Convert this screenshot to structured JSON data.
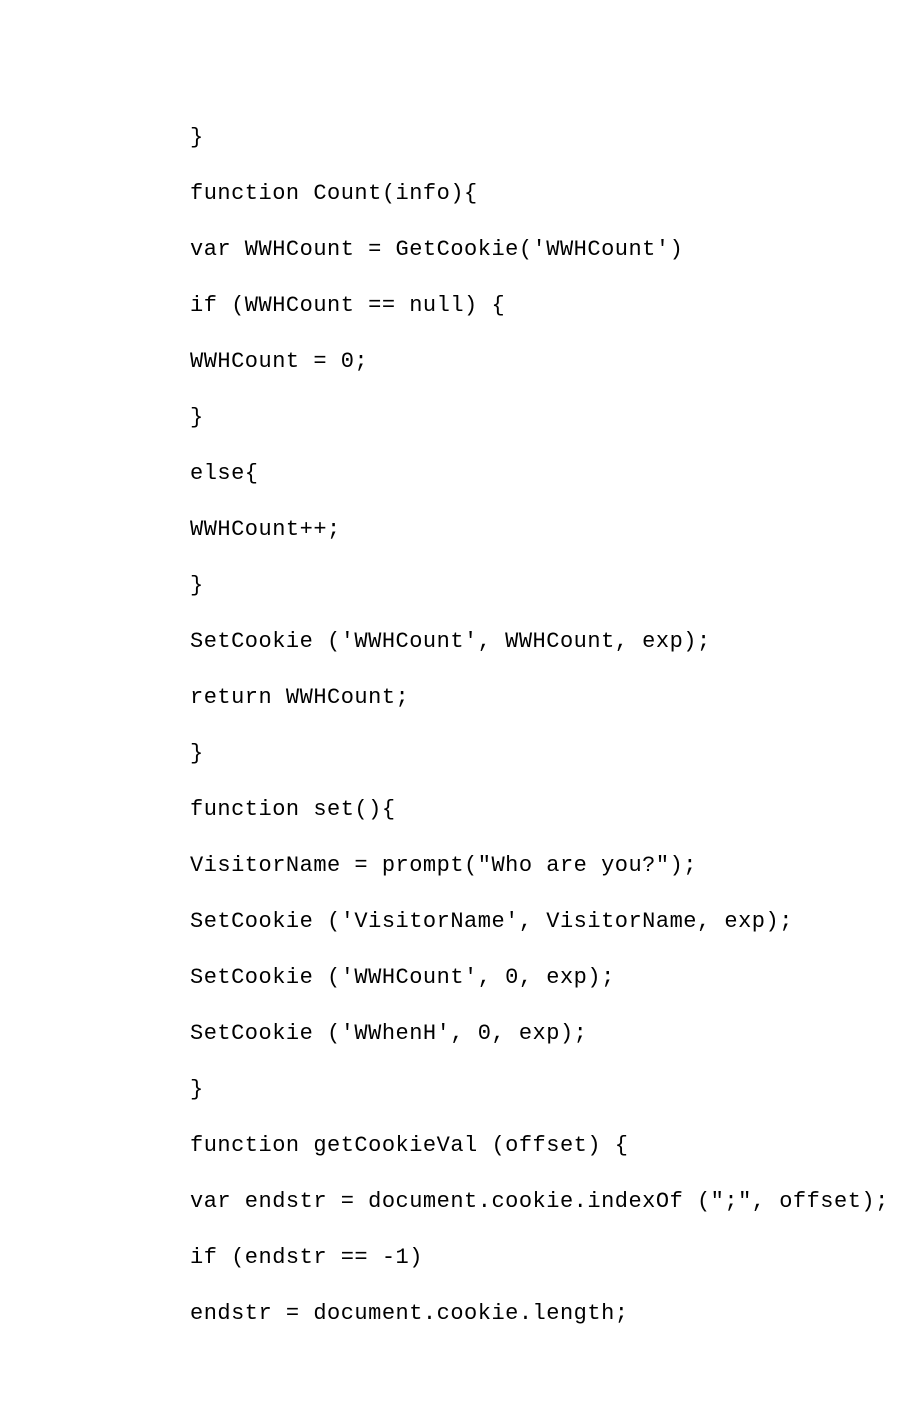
{
  "code": {
    "lines": [
      "}",
      "function Count(info){",
      "var WWHCount = GetCookie('WWHCount')",
      "if (WWHCount == null) {",
      "WWHCount = 0;",
      "}",
      "else{",
      "WWHCount++;",
      "}",
      "SetCookie ('WWHCount', WWHCount, exp);",
      "return WWHCount;",
      "}",
      "function set(){",
      "VisitorName = prompt(\"Who are you?\");",
      "SetCookie ('VisitorName', VisitorName, exp);",
      "SetCookie ('WWHCount', 0, exp);",
      "SetCookie ('WWhenH', 0, exp);",
      "}",
      "function getCookieVal (offset) {",
      "var endstr = document.cookie.indexOf (\";\", offset);",
      "if (endstr == -1)",
      "endstr = document.cookie.length;"
    ]
  }
}
